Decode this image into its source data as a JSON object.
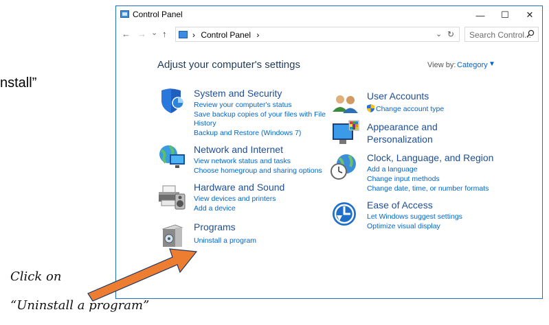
{
  "stray_text": "nstall”",
  "window": {
    "title": "Control Panel",
    "controls": {
      "minimize": "—",
      "maximize": "☐",
      "close": "✕"
    }
  },
  "address": {
    "back": "←",
    "forward": "→",
    "recent": "⌄",
    "up": "↑",
    "sep1": "›",
    "path": "Control Panel",
    "sep2": "›",
    "dropdown": "⌄",
    "refresh": "↻",
    "search_placeholder": "Search Control..."
  },
  "main": {
    "heading": "Adjust your computer's settings",
    "view_by_label": "View by:",
    "view_by_value": "Category",
    "view_by_arrow": "▼"
  },
  "categories": {
    "system": {
      "title": "System and Security",
      "links": [
        "Review your computer's status",
        "Save backup copies of your files with File",
        "History",
        "Backup and Restore (Windows 7)"
      ]
    },
    "network": {
      "title": "Network and Internet",
      "links": [
        "View network status and tasks",
        "Choose homegroup and sharing options"
      ]
    },
    "hardware": {
      "title": "Hardware and Sound",
      "links": [
        "View devices and printers",
        "Add a device"
      ]
    },
    "programs": {
      "title": "Programs",
      "links": [
        "Uninstall a program"
      ]
    },
    "users": {
      "title": "User Accounts",
      "links": [
        "Change account type"
      ]
    },
    "appearance": {
      "title_line1": "Appearance and",
      "title_line2": "Personalization"
    },
    "clock": {
      "title": "Clock, Language, and Region",
      "links": [
        "Add a language",
        "Change input methods",
        "Change date, time, or number formats"
      ]
    },
    "ease": {
      "title": "Ease of Access",
      "links": [
        "Let Windows suggest settings",
        "Optimize visual display"
      ]
    }
  },
  "annotation": {
    "line1": "Click on",
    "line2": "“Uninstall a program”",
    "arrow_color": "#ed7d31"
  }
}
